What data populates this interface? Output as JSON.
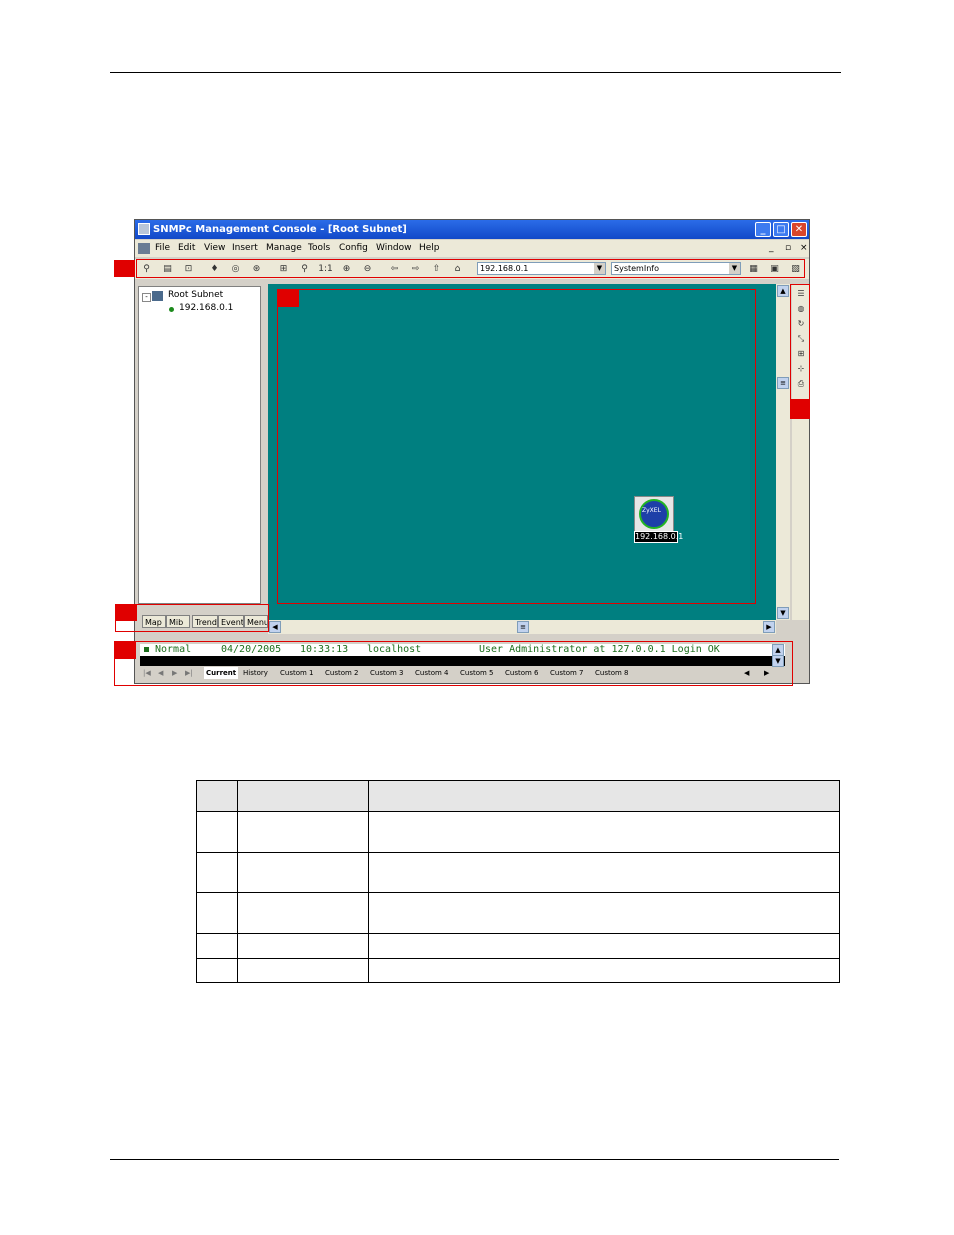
{
  "window": {
    "title": "SNMPc Management Console - [Root Subnet]",
    "menu": [
      "File",
      "Edit",
      "View",
      "Insert",
      "Manage",
      "Tools",
      "Config",
      "Window",
      "Help"
    ],
    "address_combo": "192.168.0.1",
    "info_combo": "SystemInfo"
  },
  "tree": {
    "root": "Root Subnet",
    "child": "192.168.0.1"
  },
  "left_tabs": [
    "Map",
    "Mib",
    "Trend",
    "Event",
    "Menu"
  ],
  "map": {
    "device_logo_text": "ZyXEL",
    "device_label": "192.168.0.1"
  },
  "event_log": {
    "status": "Normal",
    "date": "04/20/2005",
    "time": "10:33:13",
    "source": "localhost",
    "message": "User Administrator at 127.0.0.1 Login OK"
  },
  "event_tabs": [
    "Current",
    "History",
    "Custom 1",
    "Custom 2",
    "Custom 3",
    "Custom 4",
    "Custom 5",
    "Custom 6",
    "Custom 7",
    "Custom 8"
  ],
  "colors": {
    "map_background": "#007f80",
    "callout_red": "#e00000",
    "titlebar_blue": "#1148c8"
  }
}
